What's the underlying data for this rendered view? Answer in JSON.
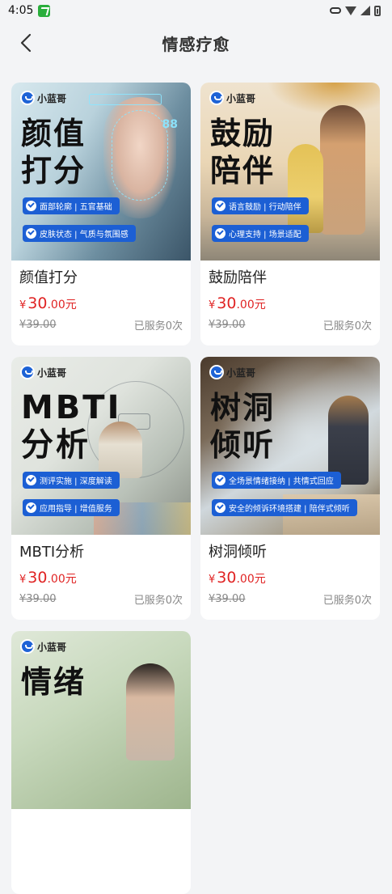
{
  "status_bar": {
    "time": "4:05"
  },
  "header": {
    "title": "情感疗愈"
  },
  "cards": [
    {
      "name": "颜值打分",
      "brand": "小蓝哥",
      "cover_title_line1": "颜值",
      "cover_title_line2": "打分",
      "tags": [
        "面部轮廓 | 五官基础",
        "皮肤状态 | 气质与氛围感"
      ],
      "price_symbol": "¥",
      "price_int": "30",
      "price_dec": ".00元",
      "original_price": "¥39.00",
      "served": "已服务0次"
    },
    {
      "name": "鼓励陪伴",
      "brand": "小蓝哥",
      "cover_title_line1": "鼓励",
      "cover_title_line2": "陪伴",
      "tags": [
        "语言鼓励 | 行动陪伴",
        "心理支持 | 场景适配"
      ],
      "price_symbol": "¥",
      "price_int": "30",
      "price_dec": ".00元",
      "original_price": "¥39.00",
      "served": "已服务0次"
    },
    {
      "name": "MBTI分析",
      "brand": "小蓝哥",
      "cover_title_line1": "MBTI",
      "cover_title_line2": "分析",
      "tags": [
        "测评实施 | 深度解读",
        "应用指导 | 增值服务"
      ],
      "price_symbol": "¥",
      "price_int": "30",
      "price_dec": ".00元",
      "original_price": "¥39.00",
      "served": "已服务0次"
    },
    {
      "name": "树洞倾听",
      "brand": "小蓝哥",
      "cover_title_line1": "树洞",
      "cover_title_line2": "倾听",
      "tags": [
        "全场景情绪接纳 | 共情式回应",
        "安全的倾诉环境搭建 | 陪伴式倾听"
      ],
      "price_symbol": "¥",
      "price_int": "30",
      "price_dec": ".00元",
      "original_price": "¥39.00",
      "served": "已服务0次"
    },
    {
      "name": "",
      "brand": "小蓝哥",
      "cover_title_line1": "情绪",
      "cover_title_line2": ""
    }
  ],
  "colors": {
    "price": "#e02323",
    "tag_bg": "#1c5fd4",
    "page_bg": "#f3f4f6"
  }
}
